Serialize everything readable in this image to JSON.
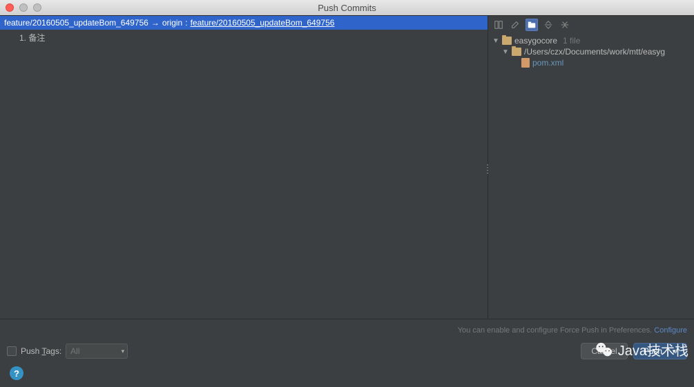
{
  "title": "Push Commits",
  "branch": {
    "source": "feature/20160505_updateBom_649756",
    "arrow": "→",
    "remote": "origin",
    "sep": ":",
    "target": "feature/20160505_updateBom_649756"
  },
  "commits": [
    {
      "num": "1.",
      "msg": "备注"
    }
  ],
  "tree": {
    "root": {
      "name": "easygocore",
      "count": "1 file"
    },
    "folder": "/Users/czx/Documents/work/mtt/easyg",
    "file": "pom.xml"
  },
  "hint": {
    "text": "You can enable and configure Force Push in Preferences. ",
    "link": "Configure"
  },
  "pushTags": {
    "label_pre": "Push ",
    "label_u": "T",
    "label_post": "ags:",
    "value": "All"
  },
  "buttons": {
    "cancel": "Cancel",
    "push": "Push"
  },
  "watermark": "Java技术栈"
}
